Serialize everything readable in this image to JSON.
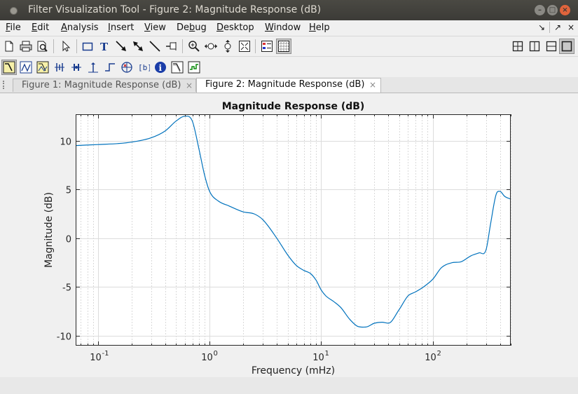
{
  "window": {
    "title": "Filter Visualization Tool - Figure 2: Magnitude Response (dB)",
    "buttons": [
      "minimize",
      "maximize",
      "close"
    ]
  },
  "menubar": {
    "items": [
      {
        "label": "File",
        "key": "F"
      },
      {
        "label": "Edit",
        "key": "E"
      },
      {
        "label": "Analysis",
        "key": "A"
      },
      {
        "label": "Insert",
        "key": "I"
      },
      {
        "label": "View",
        "key": "V"
      },
      {
        "label": "Debug",
        "key": "b"
      },
      {
        "label": "Desktop",
        "key": "D"
      },
      {
        "label": "Window",
        "key": "W"
      },
      {
        "label": "Help",
        "key": "H"
      }
    ]
  },
  "toolbar1": {
    "icons": [
      "new-file-icon",
      "print-icon",
      "print-preview-icon",
      "select-arrow-icon",
      "rectangle-icon",
      "text-icon",
      "arrow-icon",
      "double-arrow-icon",
      "line-icon",
      "pin-icon",
      "zoom-in-icon",
      "pan-icon",
      "zoom-y-icon",
      "full-view-icon",
      "legend-icon",
      "grid-icon"
    ],
    "dock_icons": [
      "tile-icon",
      "split-left-icon",
      "split-top-icon",
      "single-icon"
    ]
  },
  "toolbar2": {
    "icons": [
      "magnitude-response-icon",
      "phase-response-icon",
      "magnitude-phase-icon",
      "group-delay-icon",
      "phase-delay-icon",
      "impulse-response-icon",
      "step-response-icon",
      "pole-zero-icon",
      "filter-coefficients-icon",
      "filter-information-icon",
      "magnitude-estimate-icon",
      "round-off-noise-icon"
    ]
  },
  "tabs": [
    {
      "label": "Figure 1: Magnitude Response (dB)",
      "active": false
    },
    {
      "label": "Figure 2: Magnitude Response (dB)",
      "active": true
    }
  ],
  "colors": {
    "line": "#0072bd",
    "titlebar": "#3c3b37",
    "close_button": "#e0643c"
  },
  "chart_data": {
    "type": "line",
    "title": "Magnitude Response (dB)",
    "xlabel": "Frequency (mHz)",
    "ylabel": "Magnitude (dB)",
    "xscale": "log",
    "xlim": [
      0.063,
      500
    ],
    "ylim": [
      -11.0,
      12.7
    ],
    "xticks": [
      {
        "value": 0.1,
        "label": "10^-1"
      },
      {
        "value": 1,
        "label": "10^0"
      },
      {
        "value": 10,
        "label": "10^1"
      },
      {
        "value": 100,
        "label": "10^2"
      }
    ],
    "yticks": [
      -10,
      -5,
      0,
      5,
      10
    ],
    "grid": true,
    "series": [
      {
        "values": [
          [
            0.063,
            9.5
          ],
          [
            0.1,
            9.6
          ],
          [
            0.15,
            9.7
          ],
          [
            0.2,
            9.85
          ],
          [
            0.3,
            10.3
          ],
          [
            0.4,
            11.0
          ],
          [
            0.5,
            12.0
          ],
          [
            0.6,
            12.5
          ],
          [
            0.7,
            12.0
          ],
          [
            0.8,
            9.2
          ],
          [
            0.9,
            6.5
          ],
          [
            1.0,
            4.8
          ],
          [
            1.2,
            3.8
          ],
          [
            1.5,
            3.3
          ],
          [
            2.0,
            2.7
          ],
          [
            2.5,
            2.5
          ],
          [
            3.0,
            1.9
          ],
          [
            4.0,
            0.0
          ],
          [
            5.0,
            -1.7
          ],
          [
            6.0,
            -2.8
          ],
          [
            7.0,
            -3.3
          ],
          [
            8.0,
            -3.6
          ],
          [
            9.0,
            -4.3
          ],
          [
            10.0,
            -5.3
          ],
          [
            11.0,
            -5.9
          ],
          [
            13.0,
            -6.5
          ],
          [
            15.0,
            -7.1
          ],
          [
            18.0,
            -8.3
          ],
          [
            21.0,
            -9.0
          ],
          [
            25.0,
            -9.1
          ],
          [
            30.0,
            -8.7
          ],
          [
            35.0,
            -8.6
          ],
          [
            40.0,
            -8.7
          ],
          [
            50.0,
            -7.3
          ],
          [
            60.0,
            -5.9
          ],
          [
            70.0,
            -5.5
          ],
          [
            80.0,
            -5.1
          ],
          [
            100.0,
            -4.2
          ],
          [
            120.0,
            -3.0
          ],
          [
            150.0,
            -2.5
          ],
          [
            180.0,
            -2.4
          ],
          [
            220.0,
            -1.8
          ],
          [
            260.0,
            -1.5
          ],
          [
            300.0,
            -1.2
          ],
          [
            330.0,
            1.5
          ],
          [
            370.0,
            4.5
          ],
          [
            400.0,
            4.8
          ],
          [
            440.0,
            4.3
          ],
          [
            500.0,
            4.0
          ]
        ]
      }
    ]
  }
}
